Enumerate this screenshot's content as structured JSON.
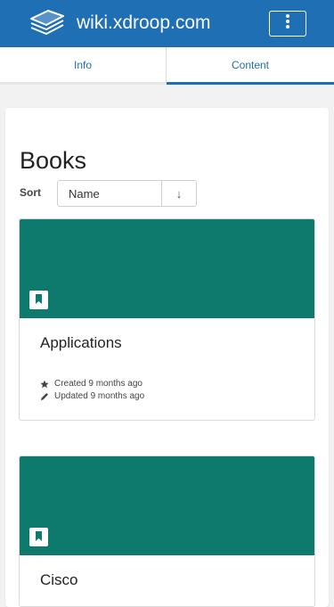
{
  "header": {
    "site_name": "wiki.xdroop.com",
    "logo_icon": "books-stack-icon",
    "menu_icon": "vertical-dots-icon",
    "background_color": "#1f6fb5"
  },
  "tabs": [
    {
      "label": "Info",
      "active": false
    },
    {
      "label": "Content",
      "active": true
    }
  ],
  "main": {
    "title": "Books",
    "sort": {
      "label": "Sort",
      "selected": "Name",
      "direction_symbol": "↓"
    },
    "books": [
      {
        "title": "Applications",
        "cover_color": "#0e7a6d",
        "created": "Created 9 months ago",
        "updated": "Updated 9 months ago"
      },
      {
        "title": "Cisco",
        "cover_color": "#0e7a6d"
      }
    ]
  }
}
